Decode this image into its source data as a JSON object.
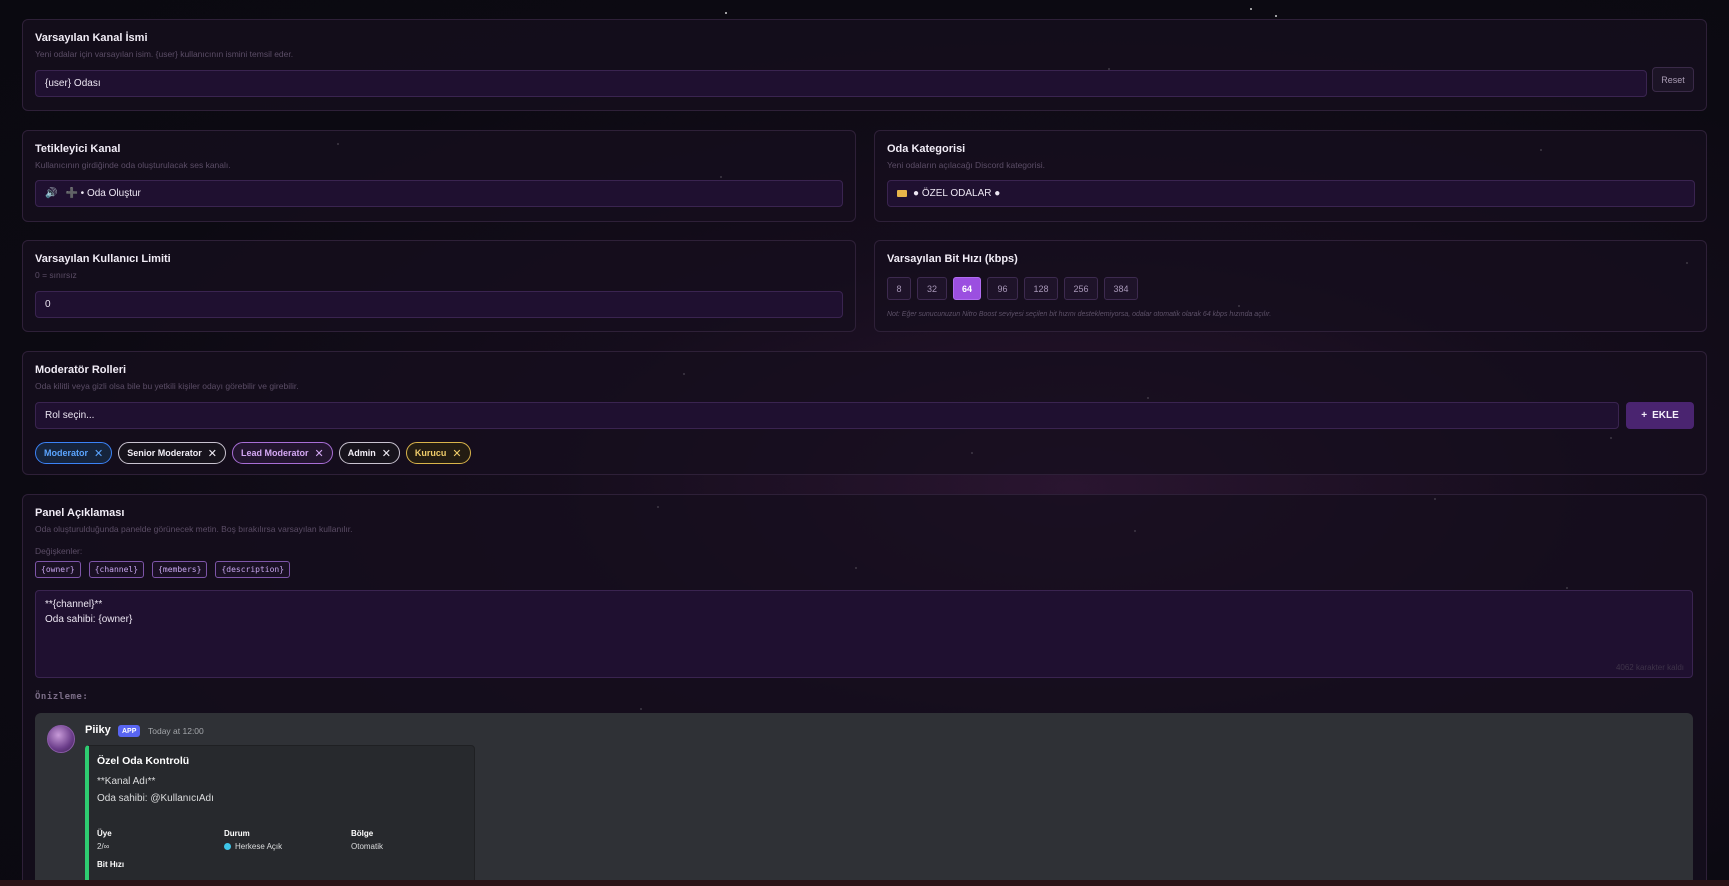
{
  "default_channel_name": {
    "title": "Varsayılan Kanal İsmi",
    "description": "Yeni odalar için varsayılan isim. {user} kullanıcının ismini temsil eder.",
    "value": "{user} Odası",
    "reset_label": "Reset"
  },
  "trigger_channel": {
    "title": "Tetikleyici Kanal",
    "description": "Kullanıcının girdiğinde oda oluşturulacak ses kanalı.",
    "icon": "speaker-icon",
    "value": "➕ • Oda Oluştur"
  },
  "room_category": {
    "title": "Oda Kategorisi",
    "description": "Yeni odaların açılacağı Discord kategorisi.",
    "icon": "folder-icon",
    "value": "● ÖZEL ODALAR ●"
  },
  "user_limit": {
    "title": "Varsayılan Kullanıcı Limiti",
    "description": "0 = sınırsız",
    "value": "0"
  },
  "bitrate": {
    "title": "Varsayılan Bit Hızı (kbps)",
    "options": [
      "8",
      "32",
      "64",
      "96",
      "128",
      "256",
      "384"
    ],
    "selected": "64",
    "note": "Not: Eğer sunucunuzun Nitro Boost seviyesi seçilen bit hızını desteklemiyorsa, odalar otomatik olarak 64 kbps hızında açılır."
  },
  "moderator_roles": {
    "title": "Moderatör Rolleri",
    "description": "Oda kilitli veya gizli olsa bile bu yetkili kişiler odayı görebilir ve girebilir.",
    "select_placeholder": "Rol seçin...",
    "add_label": "EKLE",
    "roles": [
      {
        "name": "Moderator",
        "color": "#3b82f6",
        "text": "#5ba4ff",
        "bg": "#16243c"
      },
      {
        "name": "Senior Moderator",
        "color": "#c9c3d0",
        "text": "#f2eef6",
        "bg": "#17131c"
      },
      {
        "name": "Lead Moderator",
        "color": "#a86ed6",
        "text": "#d4a8f4",
        "bg": "#23152f"
      },
      {
        "name": "Admin",
        "color": "#c9c3d0",
        "text": "#f2eef6",
        "bg": "#17131c"
      },
      {
        "name": "Kurucu",
        "color": "#d9b44a",
        "text": "#f0cd6a",
        "bg": "#231c12"
      }
    ]
  },
  "panel_description": {
    "title": "Panel Açıklaması",
    "description": "Oda oluşturulduğunda panelde görünecek metin. Boş bırakılırsa varsayılan kullanılır.",
    "variables_label": "Değişkenler:",
    "variables": [
      "{owner}",
      "{channel}",
      "{members}",
      "{description}"
    ],
    "text_line1": "**{channel}**",
    "text_line2": "Oda sahibi: {owner}",
    "char_count": "4062 karakter kaldı",
    "preview_label": "Önizleme:"
  },
  "preview": {
    "bot_name": "Piiky",
    "app_badge": "APP",
    "time": "Today at 12:00",
    "embed_title": "Özel Oda Kontrolü",
    "embed_line1": "**Kanal Adı**",
    "embed_line2": "Oda sahibi: @KullanıcıAdı",
    "fields": [
      {
        "name": "Üye",
        "value": "2/∞"
      },
      {
        "name": "Durum",
        "value": "Herkese Açık"
      },
      {
        "name": "Bölge",
        "value": "Otomatik"
      }
    ],
    "more_field": "Bit Hızı",
    "accent": "#2ecc71"
  }
}
